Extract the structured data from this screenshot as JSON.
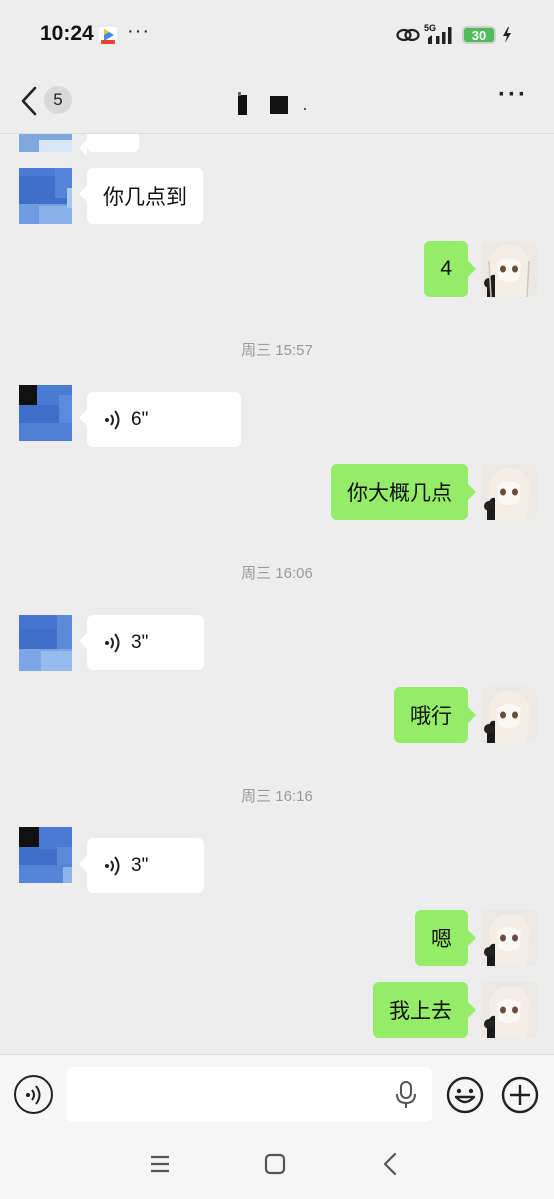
{
  "status_bar": {
    "time": "10:24",
    "dots": "···",
    "network": "5G",
    "battery": "30"
  },
  "header": {
    "unread_count": "5",
    "title": "",
    "more": "···"
  },
  "messages": [
    {
      "side": "left",
      "type": "text",
      "text": "你几点到"
    },
    {
      "side": "right",
      "type": "text",
      "text": "4"
    },
    {
      "type": "time",
      "text": "周三 15:57"
    },
    {
      "side": "left",
      "type": "voice",
      "duration": "6\""
    },
    {
      "side": "right",
      "type": "text",
      "text": "你大概几点"
    },
    {
      "type": "time",
      "text": "周三 16:06"
    },
    {
      "side": "left",
      "type": "voice",
      "duration": "3\""
    },
    {
      "side": "right",
      "type": "text",
      "text": "哦行"
    },
    {
      "type": "time",
      "text": "周三 16:16"
    },
    {
      "side": "left",
      "type": "voice",
      "duration": "3\""
    },
    {
      "side": "right",
      "type": "text",
      "text": "嗯"
    },
    {
      "side": "right",
      "type": "text",
      "text": "我上去"
    }
  ],
  "input": {
    "value": "",
    "placeholder": ""
  },
  "colors": {
    "background": "#ededed",
    "bubble_self": "#95ec69",
    "bubble_other": "#ffffff",
    "timestamp": "#9a9a9a",
    "battery": "#4fbb5a"
  },
  "icons": [
    "back-chevron-icon",
    "more-icon",
    "voice-wave-icon",
    "voice-toggle-icon",
    "mic-icon",
    "emoji-icon",
    "plus-icon",
    "nav-menu-icon",
    "nav-home-icon",
    "nav-back-icon"
  ]
}
